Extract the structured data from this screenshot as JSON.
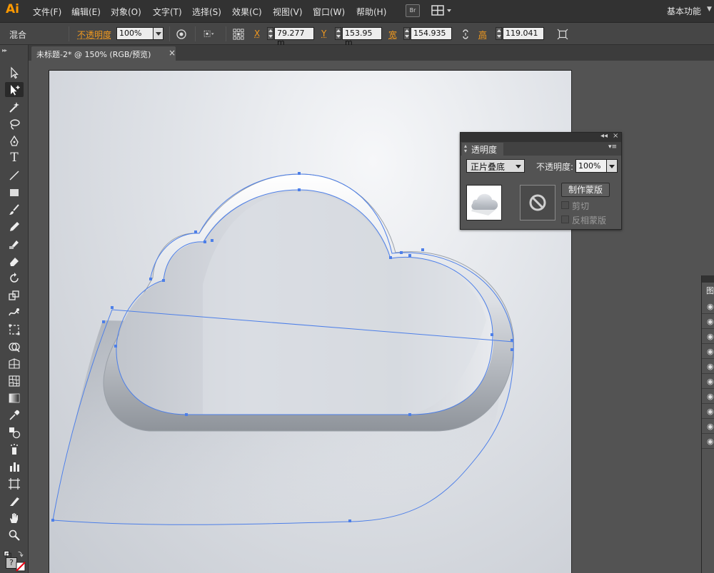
{
  "app": {
    "logo": "Ai",
    "menus": [
      "文件(F)",
      "编辑(E)",
      "对象(O)",
      "文字(T)",
      "选择(S)",
      "效果(C)",
      "视图(V)",
      "窗口(W)",
      "帮助(H)"
    ],
    "bridge_label": "Br",
    "workspace": "基本功能"
  },
  "control": {
    "mode": "混合",
    "opacity_label": "不透明度",
    "opacity_value": "100%",
    "x_label": "X",
    "x_value": "79.277 m",
    "y_label": "Y",
    "y_value": "153.95 m",
    "w_label": "宽",
    "w_value": "154.935",
    "h_label": "高",
    "h_value": "119.041"
  },
  "document": {
    "tab_label": "未标题-2* @ 150% (RGB/预览)",
    "close": "×"
  },
  "toolbox": {
    "grip": "▸▸",
    "tools": [
      "selection-tool",
      "direct-selection-tool",
      "magic-wand-tool",
      "lasso-tool",
      "pen-tool",
      "type-tool",
      "line-tool",
      "rectangle-tool",
      "paintbrush-tool",
      "pencil-tool",
      "blob-brush-tool",
      "eraser-tool",
      "rotate-tool",
      "scale-tool",
      "warp-tool",
      "free-transform-tool",
      "shape-builder-tool",
      "perspective-grid-tool",
      "mesh-tool",
      "gradient-tool",
      "eyedropper-tool",
      "blend-tool",
      "symbol-sprayer-tool",
      "column-graph-tool",
      "artboard-tool",
      "slice-tool",
      "hand-tool",
      "zoom-tool"
    ],
    "help_glyph": "?"
  },
  "transparency_panel": {
    "collapse": "◂◂",
    "close": "×",
    "title": "透明度",
    "menu": "▾≡",
    "blend_mode": "正片叠底",
    "opacity_label": "不透明度:",
    "opacity_value": "100%",
    "make_mask": "制作蒙版",
    "clip_label": "剪切",
    "invert_label": "反相蒙版"
  },
  "layers_panel": {
    "tab_label": "图",
    "eye_glyph": "◉",
    "rows": 10
  },
  "colors": {
    "accent_orange": "#f39a1e",
    "selection_blue": "#4d7fe8",
    "ui_dark": "#323232",
    "ui_mid": "#535353"
  }
}
